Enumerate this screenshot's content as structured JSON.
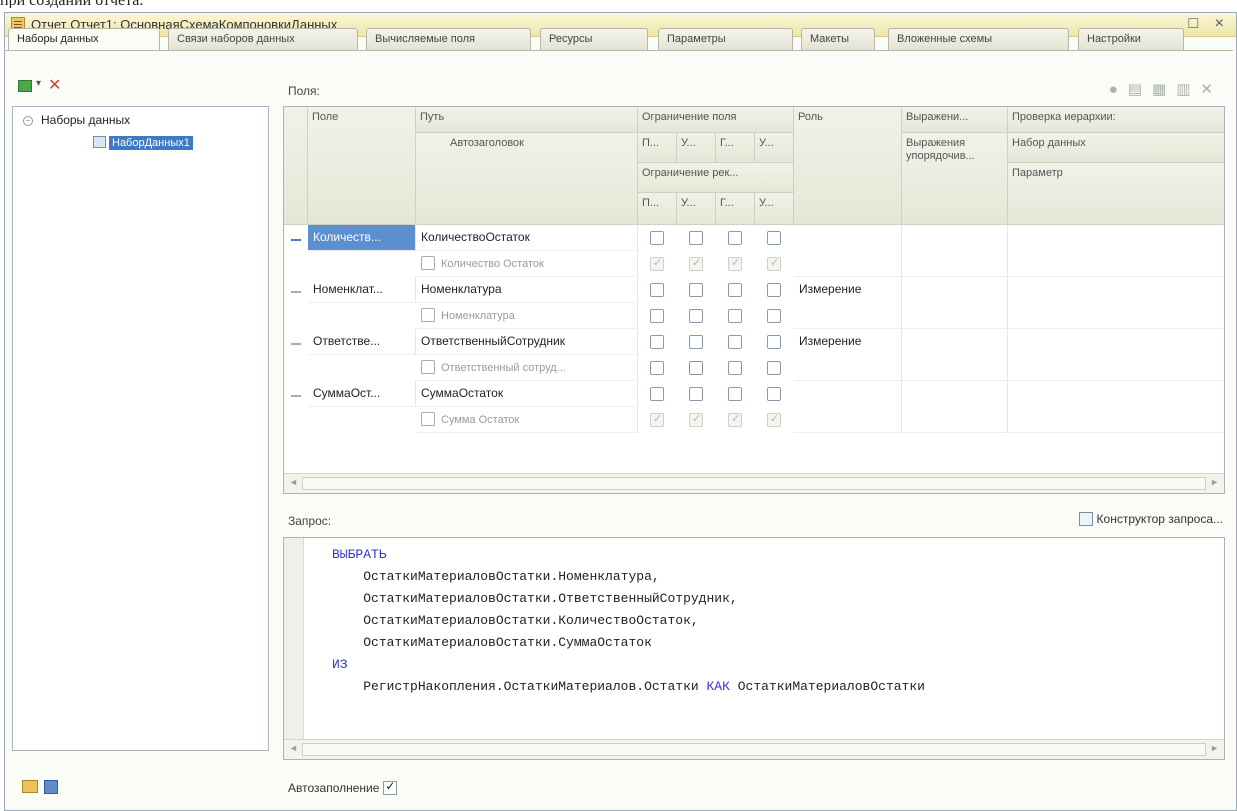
{
  "caption_fragment": "при создании отчета.",
  "window": {
    "title": "Отчет Отчет1: ОсновнаяСхемаКомпоновкиДанных",
    "min": "_",
    "max": "□",
    "close": "×"
  },
  "tabs": [
    "Наборы данных",
    "Связи наборов данных",
    "Вычисляемые поля",
    "Ресурсы",
    "Параметры",
    "Макеты",
    "Вложенные схемы",
    "Настройки"
  ],
  "tree": {
    "root": "Наборы данных",
    "child": "НаборДанных1"
  },
  "fields_label": "Поля:",
  "headers": {
    "field": "Поле",
    "path": "Путь",
    "autotitle": "Автозаголовок",
    "field_restriction": "Ограничение поля",
    "req_restriction": "Ограничение рек...",
    "restriction_cols": [
      "П...",
      "У...",
      "Г...",
      "У..."
    ],
    "role": "Роль",
    "expression": "Выражени...",
    "order_expr": "Выражения упорядочив...",
    "hierarchy": "Проверка иерархии:",
    "dataset": "Набор данных",
    "parameter": "Параметр"
  },
  "rows": [
    {
      "field": "Количеств...",
      "path": "КоличествоОстаток",
      "title": "Количество Остаток",
      "role": "",
      "selected": true,
      "top_checks": [
        false,
        false,
        false,
        false
      ],
      "sub_checks": "ghost"
    },
    {
      "field": "Номенклат...",
      "path": "Номенклатура",
      "title": "Номенклатура",
      "role": "Измерение",
      "selected": false,
      "top_checks": [
        false,
        false,
        false,
        false
      ],
      "sub_checks": "empty"
    },
    {
      "field": "Ответстве...",
      "path": "ОтветственныйСотрудник",
      "title": "Ответственный сотруд...",
      "role": "Измерение",
      "selected": false,
      "top_checks": [
        false,
        false,
        false,
        false
      ],
      "sub_checks": "empty"
    },
    {
      "field": "СуммаОст...",
      "path": "СуммаОстаток",
      "title": "Сумма Остаток",
      "role": "",
      "selected": false,
      "top_checks": [
        false,
        false,
        false,
        false
      ],
      "sub_checks": "ghost"
    }
  ],
  "query_label": "Запрос:",
  "query_builder": "Конструктор запроса...",
  "query": {
    "select_kw": "ВЫБРАТЬ",
    "lines": [
      "ОстаткиМатериаловОстатки.Номенклатура,",
      "ОстаткиМатериаловОстатки.ОтветственныйСотрудник,",
      "ОстаткиМатериаловОстатки.КоличествоОстаток,",
      "ОстаткиМатериаловОстатки.СуммаОстаток"
    ],
    "from_kw": "ИЗ",
    "from_source": "РегистрНакопления.ОстаткиМатериалов.Остатки",
    "as_kw": "КАК",
    "alias": "ОстаткиМатериаловОстатки"
  },
  "autofill_label": "Автозаполнение",
  "autofill_checked": true,
  "icons": [
    "add-icon",
    "delete-icon",
    "folder-icon",
    "save-icon",
    "query-builder-icon",
    "dataset-icon"
  ]
}
